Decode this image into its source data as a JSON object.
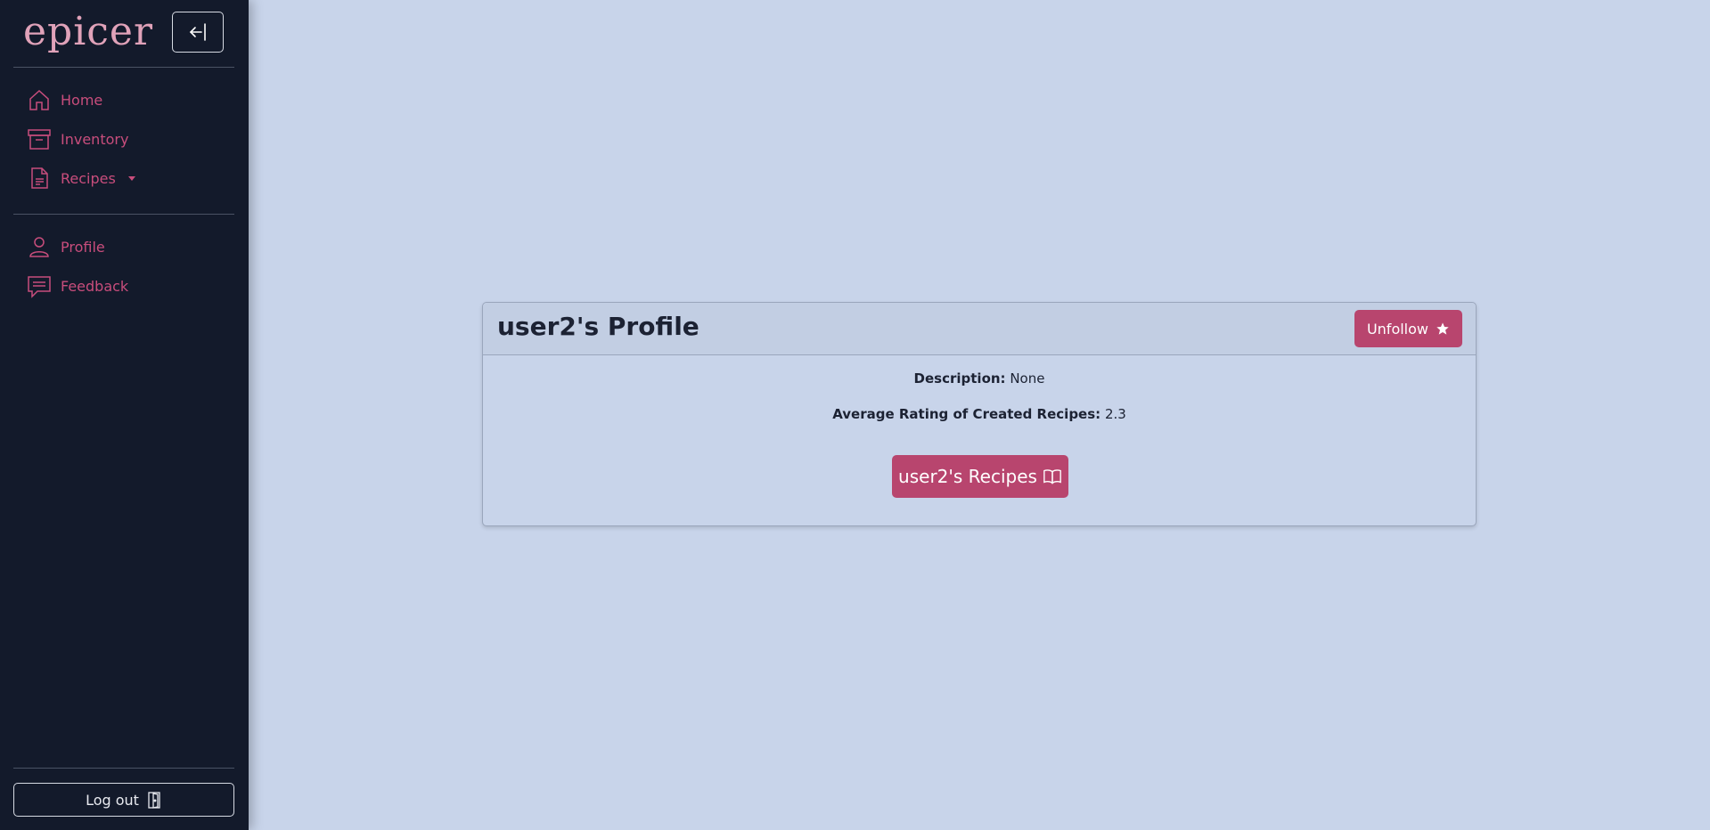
{
  "sidebar": {
    "logo": "epicer",
    "nav": [
      {
        "label": "Home"
      },
      {
        "label": "Inventory"
      },
      {
        "label": "Recipes"
      },
      {
        "label": "Profile"
      },
      {
        "label": "Feedback"
      }
    ],
    "logout_label": "Log out"
  },
  "profile": {
    "title": "user2's Profile",
    "unfollow_label": "Unfollow",
    "description_label": "Description:",
    "description_value": "None",
    "rating_label": "Average Rating of Created Recipes:",
    "rating_value": "2.3",
    "recipes_button_label": "user2's Recipes"
  },
  "colors": {
    "accent": "#b8456e",
    "sidebar_bg": "#131a2b",
    "page_bg": "#c8d4ea"
  }
}
